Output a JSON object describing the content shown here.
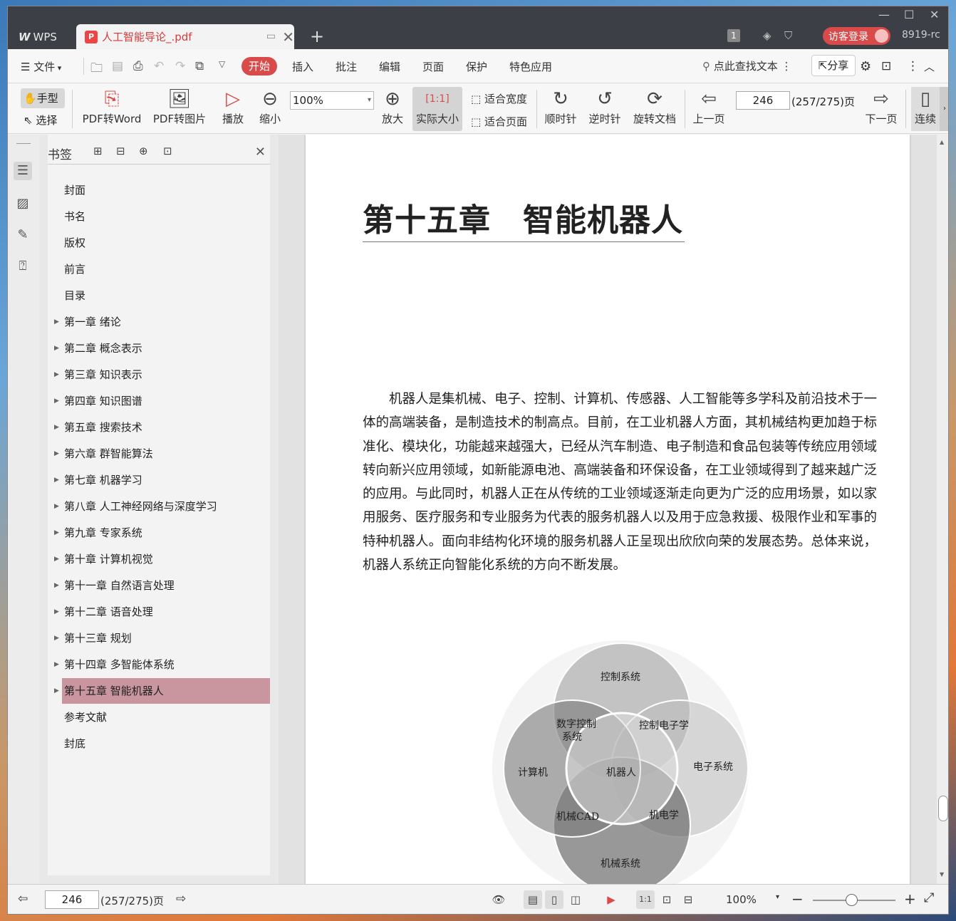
{
  "window": {
    "app": "WPS",
    "tab_title": "人工智能导论_.pdf",
    "login": "访客登录",
    "user_id": "8919-rc",
    "badge": "1"
  },
  "menu": {
    "file": "文件",
    "items": [
      "开始",
      "插入",
      "批注",
      "编辑",
      "页面",
      "保护",
      "特色应用"
    ],
    "search": "点此查找文本",
    "share": "分享"
  },
  "ribbon": {
    "hand": "手型",
    "select": "选择",
    "pdf2word": "PDF转Word",
    "pdf2img": "PDF转图片",
    "play": "播放",
    "zoom_out": "缩小",
    "zoom_value": "100%",
    "zoom_in": "放大",
    "actual": "实际大小",
    "fit_width": "适合宽度",
    "fit_page": "适合页面",
    "cw": "顺时针",
    "ccw": "逆时针",
    "rotate_doc": "旋转文档",
    "prev": "上一页",
    "page": "246",
    "page_total": "(257/275)页",
    "next": "下一页",
    "continuous": "连续"
  },
  "bookmarks": {
    "title": "书签",
    "items": [
      "封面",
      "书名",
      "版权",
      "前言",
      "目录",
      "第一章 绪论",
      "第二章 概念表示",
      "第三章 知识表示",
      "第四章 知识图谱",
      "第五章 搜索技术",
      "第六章 群智能算法",
      "第七章 机器学习",
      "第八章 人工神经网络与深度学习",
      "第九章 专家系统",
      "第十章 计算机视觉",
      "第十一章 自然语言处理",
      "第十二章 语音处理",
      "第十三章 规划",
      "第十四章 多智能体系统",
      "第十五章 智能机器人",
      "参考文献",
      "封底"
    ]
  },
  "doc": {
    "chapter_title": "第十五章　智能机器人",
    "paragraph": "机器人是集机械、电子、控制、计算机、传感器、人工智能等多学科及前沿技术于一体的高端装备，是制造技术的制高点。目前，在工业机器人方面，其机械结构更加趋于标准化、模块化，功能越来越强大，已经从汽车制造、电子制造和食品包装等传统应用领域转向新兴应用领域，如新能源电池、高端装备和环保设备，在工业领域得到了越来越广泛的应用。与此同时，机器人正在从传统的工业领域逐渐走向更为广泛的应用场景，如以家用服务、医疗服务和专业服务为代表的服务机器人以及用于应急救援、极限作业和军事的特种机器人。面向非结构化环境的服务机器人正呈现出欣欣向荣的发展态势。总体来说，机器人系统正向智能化系统的方向不断发展。",
    "venn": {
      "top": "控制系统",
      "left": "计算机",
      "right": "电子系统",
      "bottom": "机械系统",
      "tl": "数字控制",
      "tl2": "系统",
      "tr": "控制电子学",
      "center": "机器人",
      "bl": "机械CAD",
      "br": "机电学"
    }
  },
  "status": {
    "page": "246",
    "page_total": "(257/275)页",
    "zoom": "100%"
  }
}
